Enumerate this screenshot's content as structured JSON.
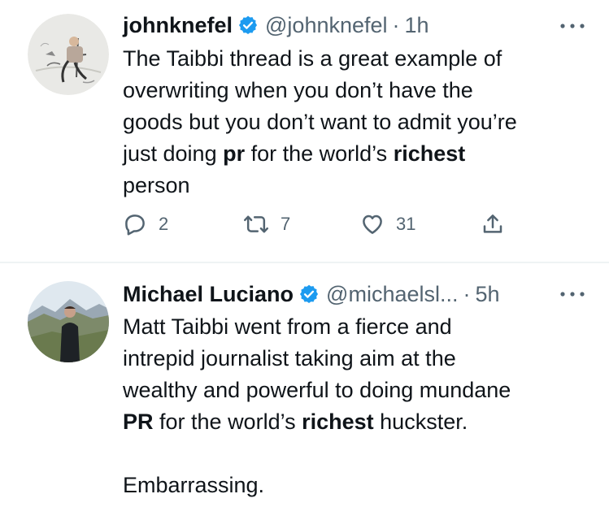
{
  "tweets": [
    {
      "author_name": "johnknefel",
      "handle": "@johnknefel",
      "separator": "·",
      "time": "1h",
      "verified_icon": "verified-badge-icon",
      "more_icon": "more-options-icon",
      "text_lines": [
        {
          "segments": [
            {
              "t": "The Taibbi thread is a great example of",
              "b": false
            }
          ]
        },
        {
          "segments": [
            {
              "t": "overwriting when you don’t have the",
              "b": false
            }
          ]
        },
        {
          "segments": [
            {
              "t": "goods but you don’t want to admit you’re",
              "b": false
            }
          ]
        },
        {
          "segments": [
            {
              "t": "just doing ",
              "b": false
            },
            {
              "t": "pr",
              "b": true
            },
            {
              "t": " for the world’s ",
              "b": false
            },
            {
              "t": "richest",
              "b": true
            }
          ]
        },
        {
          "segments": [
            {
              "t": "person",
              "b": false
            }
          ]
        }
      ],
      "actions": {
        "replies": "2",
        "retweets": "7",
        "likes": "31"
      }
    },
    {
      "author_name": "Michael Luciano",
      "handle": "@michaelsl...",
      "separator": "·",
      "time": "5h",
      "verified_icon": "verified-badge-icon",
      "more_icon": "more-options-icon",
      "text_lines": [
        {
          "segments": [
            {
              "t": "Matt Taibbi went from a fierce and",
              "b": false
            }
          ]
        },
        {
          "segments": [
            {
              "t": "intrepid journalist taking aim at the",
              "b": false
            }
          ]
        },
        {
          "segments": [
            {
              "t": "wealthy and powerful to doing mundane",
              "b": false
            }
          ]
        },
        {
          "segments": [
            {
              "t": "PR",
              "b": true
            },
            {
              "t": " for the world’s ",
              "b": false
            },
            {
              "t": "richest",
              "b": true
            },
            {
              "t": " huckster.",
              "b": false
            }
          ]
        },
        {
          "segments": []
        },
        {
          "segments": [
            {
              "t": "Embarrassing.",
              "b": false
            }
          ]
        }
      ]
    }
  ],
  "colors": {
    "text": "#0f1419",
    "secondary": "#536471",
    "verified_blue": "#1d9bf0",
    "divider": "#eff3f4"
  }
}
